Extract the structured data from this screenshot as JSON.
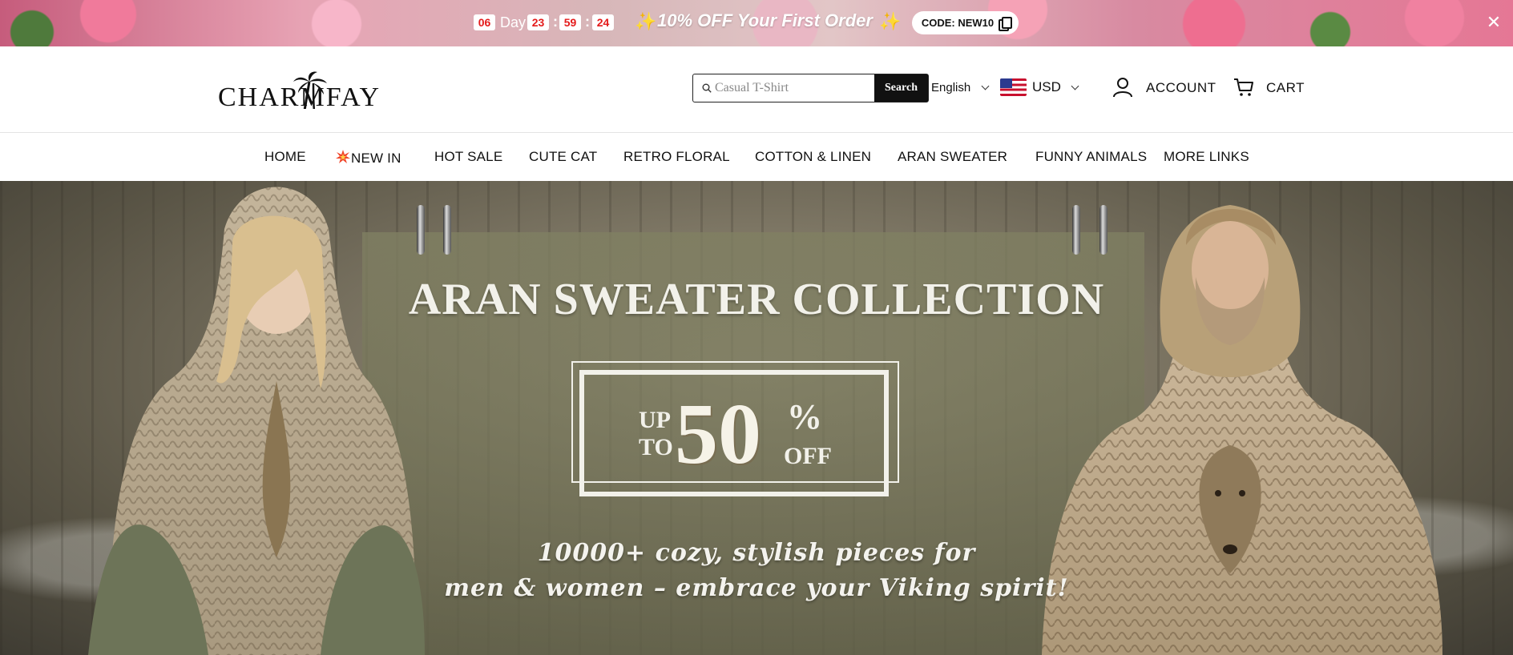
{
  "promo": {
    "countdown": {
      "days": "06",
      "day_label": "Day",
      "hours": "23",
      "minutes": "59",
      "seconds": "24",
      "separator": ":"
    },
    "sparkle": "✨",
    "offer_text": "10% OFF Your First Order",
    "code_label": "CODE: NEW10",
    "close_symbol": "✕",
    "colors": {
      "countdown_text": "#e41b1b",
      "banner_rose": "#e57795"
    }
  },
  "header": {
    "logo_text": "CHARMFAY",
    "search": {
      "placeholder": "Casual T-Shirt",
      "value": "",
      "button_label": "Search"
    },
    "language": "English",
    "currency": "USD",
    "account_label": "ACCOUNT",
    "cart_label": "CART"
  },
  "nav": {
    "items": [
      {
        "label": "HOME"
      },
      {
        "label": "NEW IN",
        "icon": "explosion-icon"
      },
      {
        "label": "HOT SALE"
      },
      {
        "label": "CUTE CAT"
      },
      {
        "label": "RETRO FLORAL"
      },
      {
        "label": "COTTON & LINEN"
      },
      {
        "label": "ARAN SWEATER"
      },
      {
        "label": "FUNNY ANIMALS"
      },
      {
        "label": "MORE LINKS"
      }
    ]
  },
  "hero": {
    "title": "ARAN SWEATER COLLECTION",
    "sale_upto": "UP TO",
    "sale_up": "UP",
    "sale_to": "TO",
    "sale_number": "50",
    "sale_percent": "%",
    "sale_off": "OFF",
    "subtitle_line1": "10000+ cozy, stylish pieces for",
    "subtitle_line2": "men & women – embrace your Viking spirit!"
  }
}
